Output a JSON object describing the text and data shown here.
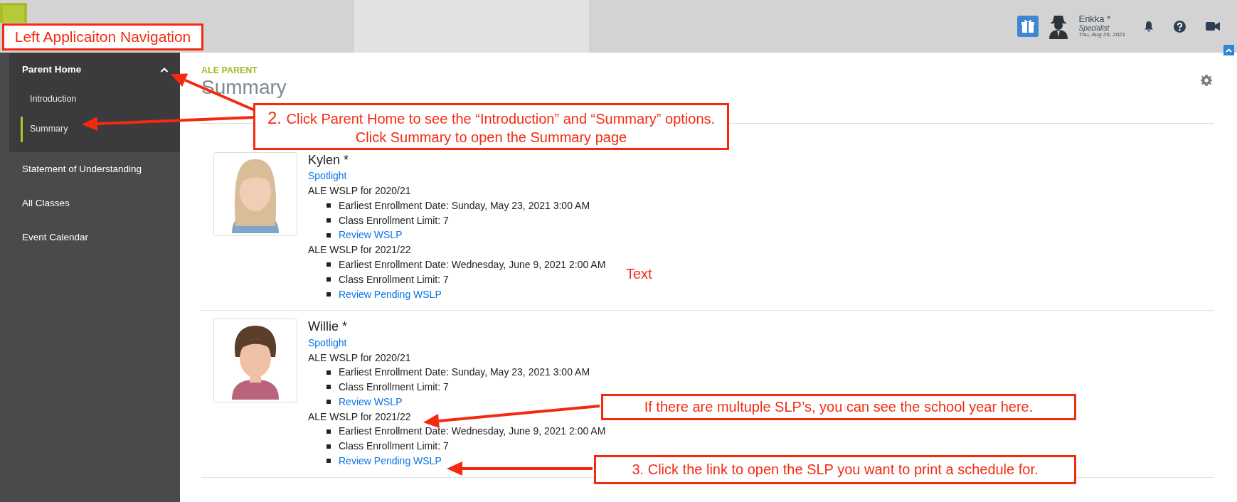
{
  "header": {
    "user": {
      "name": "Erikka *",
      "role": "Specialist",
      "date": "Thu, Aug 26, 2021"
    }
  },
  "sidebar": {
    "items": [
      {
        "label": "Parent Home",
        "expanded": true,
        "children": [
          {
            "label": "Introduction",
            "selected": false
          },
          {
            "label": "Summary",
            "selected": true
          }
        ]
      },
      {
        "label": "Statement of Understanding"
      },
      {
        "label": "All Classes"
      },
      {
        "label": "Event Calendar"
      }
    ]
  },
  "page": {
    "section": "ALE PARENT",
    "title": "Summary"
  },
  "students": [
    {
      "name": "Kylen *",
      "photo": {
        "kind": "picture"
      },
      "spotlight": "Spotlight",
      "plans": [
        {
          "title": "ALE WSLP for 2020/21",
          "details": [
            {
              "kind": "text",
              "text": "Earliest Enrollment Date: Sunday, May 23, 2021 3:00 AM"
            },
            {
              "kind": "text",
              "text": "Class Enrollment Limit: 7"
            },
            {
              "kind": "link",
              "text": "Review WSLP"
            }
          ]
        },
        {
          "title": "ALE WSLP for 2021/22",
          "details": [
            {
              "kind": "text",
              "text": "Earliest Enrollment Date: Wednesday, June 9, 2021 2:00 AM"
            },
            {
              "kind": "text",
              "text": "Class Enrollment Limit: 7"
            },
            {
              "kind": "link",
              "text": "Review Pending WSLP"
            }
          ]
        }
      ]
    },
    {
      "name": "Willie *",
      "photo": {
        "kind": "picture"
      },
      "spotlight": "Spotlight",
      "plans": [
        {
          "title": "ALE WSLP for 2020/21",
          "details": [
            {
              "kind": "text",
              "text": "Earliest Enrollment Date: Sunday, May 23, 2021 3:00 AM"
            },
            {
              "kind": "text",
              "text": "Class Enrollment Limit: 7"
            },
            {
              "kind": "link",
              "text": "Review WSLP"
            }
          ]
        },
        {
          "title": "ALE WSLP for 2021/22",
          "details": [
            {
              "kind": "text",
              "text": "Earliest Enrollment Date: Wednesday, June 9, 2021 2:00 AM"
            },
            {
              "kind": "text",
              "text": "Class Enrollment Limit: 7"
            },
            {
              "kind": "link",
              "text": "Review Pending WSLP"
            }
          ]
        }
      ]
    }
  ],
  "annotations": [
    {
      "kind": "callout",
      "text": "Left Applicaiton Navigation"
    },
    {
      "kind": "callout",
      "number": "2.",
      "text": "Click Parent Home to see the “Introduction” and “Summary” options. Click Summary to open the Summary page"
    },
    {
      "kind": "label",
      "text": "Text"
    },
    {
      "kind": "callout",
      "text": "If there are multuple SLP’s, you can see the school year here."
    },
    {
      "kind": "callout",
      "text": "3. Click the link to open the SLP you want to print a schedule for."
    }
  ]
}
